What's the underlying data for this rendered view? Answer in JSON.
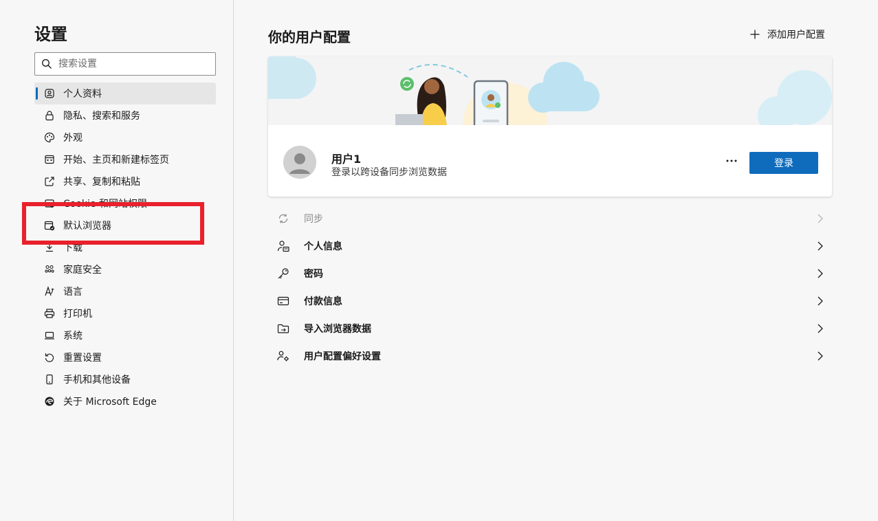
{
  "sidebar": {
    "title": "设置",
    "search_placeholder": "搜索设置",
    "items": [
      {
        "label": "个人资料",
        "icon": "profile-icon",
        "active": true
      },
      {
        "label": "隐私、搜索和服务",
        "icon": "lock-icon"
      },
      {
        "label": "外观",
        "icon": "palette-icon"
      },
      {
        "label": "开始、主页和新建标签页",
        "icon": "home-tabs-icon"
      },
      {
        "label": "共享、复制和粘贴",
        "icon": "share-icon"
      },
      {
        "label": "Cookie 和网站权限",
        "icon": "cookie-permissions-icon"
      },
      {
        "label": "默认浏览器",
        "icon": "default-browser-icon"
      },
      {
        "label": "下载",
        "icon": "download-icon"
      },
      {
        "label": "家庭安全",
        "icon": "family-icon"
      },
      {
        "label": "语言",
        "icon": "language-icon"
      },
      {
        "label": "打印机",
        "icon": "printer-icon"
      },
      {
        "label": "系统",
        "icon": "laptop-icon"
      },
      {
        "label": "重置设置",
        "icon": "reset-icon"
      },
      {
        "label": "手机和其他设备",
        "icon": "phone-icon"
      },
      {
        "label": "关于 Microsoft Edge",
        "icon": "edge-logo-icon"
      }
    ]
  },
  "main": {
    "title": "你的用户配置",
    "add_profile_label": "添加用户配置",
    "profile": {
      "name": "用户1",
      "subtitle": "登录以跨设备同步浏览数据",
      "signin_label": "登录",
      "more_label": "···"
    },
    "rows": [
      {
        "label": "同步",
        "icon": "sync-icon",
        "disabled": true
      },
      {
        "label": "个人信息",
        "icon": "person-card-icon"
      },
      {
        "label": "密码",
        "icon": "key-icon"
      },
      {
        "label": "付款信息",
        "icon": "credit-card-icon"
      },
      {
        "label": "导入浏览器数据",
        "icon": "import-folder-icon"
      },
      {
        "label": "用户配置偏好设置",
        "icon": "people-settings-icon"
      }
    ]
  },
  "colors": {
    "accent": "#0f6cbd",
    "highlight": "#e8212c"
  }
}
